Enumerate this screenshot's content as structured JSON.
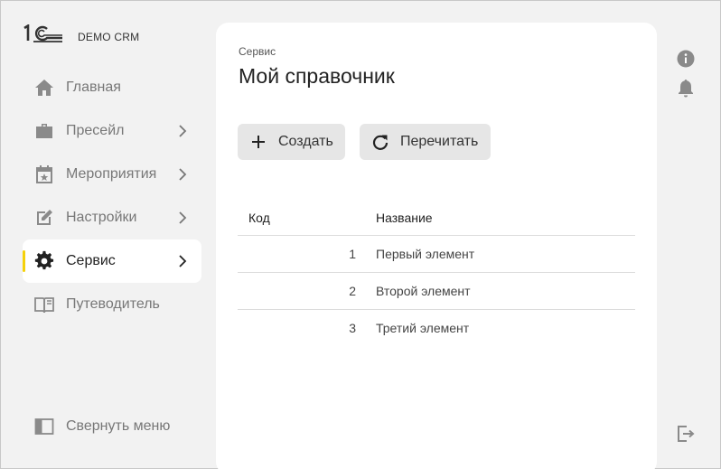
{
  "app": {
    "name": "DEMO CRM"
  },
  "sidebar": {
    "items": [
      {
        "label": "Главная",
        "icon": "home-icon",
        "has_submenu": false,
        "active": false
      },
      {
        "label": "Пресейл",
        "icon": "briefcase-icon",
        "has_submenu": true,
        "active": false
      },
      {
        "label": "Мероприятия",
        "icon": "calendar-star-icon",
        "has_submenu": true,
        "active": false
      },
      {
        "label": "Настройки",
        "icon": "edit-note-icon",
        "has_submenu": true,
        "active": false
      },
      {
        "label": "Сервис",
        "icon": "gear-icon",
        "has_submenu": true,
        "active": true
      },
      {
        "label": "Путеводитель",
        "icon": "book-icon",
        "has_submenu": false,
        "active": false
      }
    ],
    "collapse_label": "Свернуть меню"
  },
  "main": {
    "breadcrumb": "Сервис",
    "title": "Мой справочник",
    "toolbar": {
      "create_label": "Создать",
      "reread_label": "Перечитать"
    },
    "table": {
      "columns": [
        "Код",
        "Название"
      ],
      "rows": [
        {
          "code": "1",
          "name": "Первый элемент"
        },
        {
          "code": "2",
          "name": "Второй элемент"
        },
        {
          "code": "3",
          "name": "Третий элемент"
        }
      ]
    }
  },
  "colors": {
    "accent": "#f5d10a",
    "background": "#f2f2f2",
    "card": "#ffffff",
    "button": "#e6e6e6"
  }
}
